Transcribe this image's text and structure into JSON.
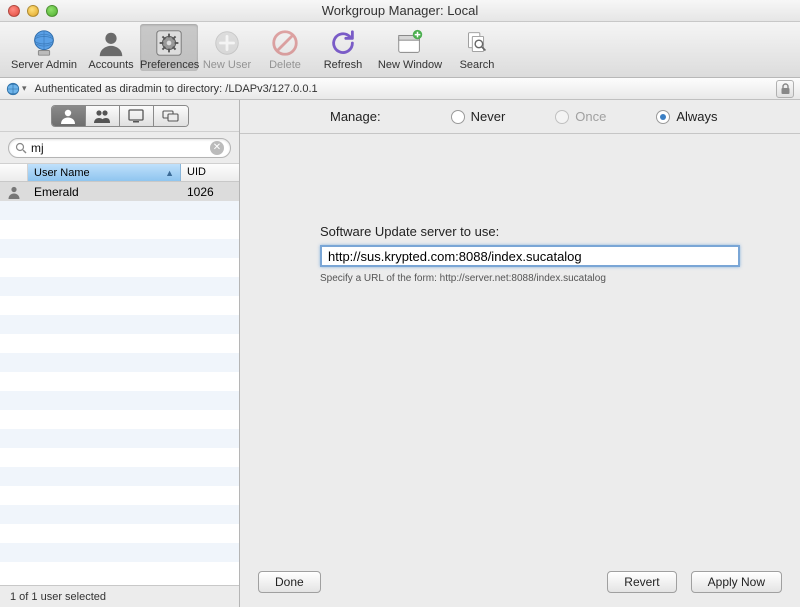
{
  "window": {
    "title": "Workgroup Manager: Local"
  },
  "toolbar": {
    "server_admin": "Server Admin",
    "accounts": "Accounts",
    "preferences": "Preferences",
    "new_user": "New User",
    "delete": "Delete",
    "refresh": "Refresh",
    "new_window": "New Window",
    "search": "Search"
  },
  "auth": {
    "text": "Authenticated as diradmin to directory: /LDAPv3/127.0.0.1"
  },
  "sidebar": {
    "search_value": "mj",
    "columns": {
      "name": "User Name",
      "uid": "UID"
    },
    "rows": [
      {
        "name": "Emerald",
        "uid": "1026"
      }
    ],
    "status": "1 of 1 user selected"
  },
  "manage": {
    "label": "Manage:",
    "never": "Never",
    "once": "Once",
    "always": "Always",
    "selected": "always"
  },
  "form": {
    "label": "Software Update server to use:",
    "value": "http://sus.krypted.com:8088/index.sucatalog",
    "hint": "Specify a URL of the form: http://server.net:8088/index.sucatalog"
  },
  "buttons": {
    "done": "Done",
    "revert": "Revert",
    "apply": "Apply Now"
  }
}
